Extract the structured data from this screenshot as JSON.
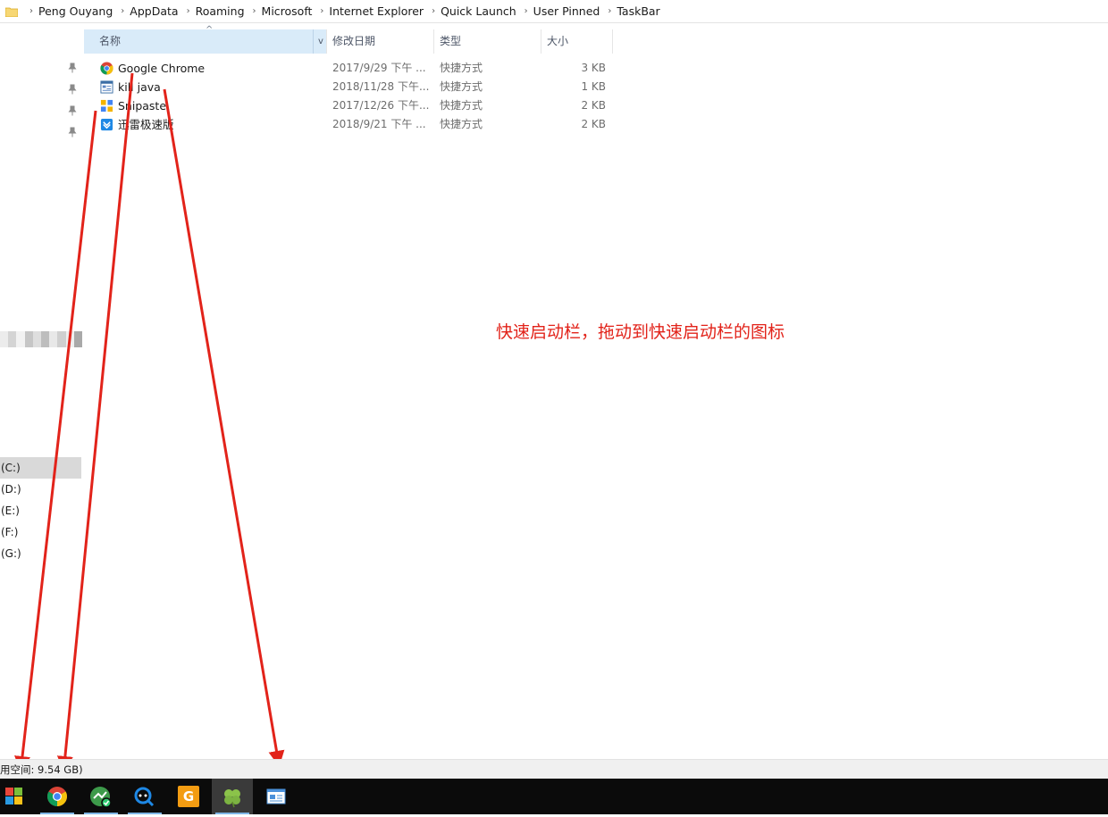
{
  "address_bar": {
    "folder_icon": "folder-icon",
    "crumbs": [
      "Peng Ouyang",
      "AppData",
      "Roaming",
      "Microsoft",
      "Internet Explorer",
      "Quick Launch",
      "User Pinned",
      "TaskBar"
    ],
    "separator": "›"
  },
  "nav_pane": {
    "drives": [
      {
        "label": "(C:)",
        "selected": true
      },
      {
        "label": "(D:)",
        "selected": false
      },
      {
        "label": "(E:)",
        "selected": false
      },
      {
        "label": "(F:)",
        "selected": false
      },
      {
        "label": "(G:)",
        "selected": false
      }
    ]
  },
  "columns": {
    "name": "名称",
    "date": "修改日期",
    "type": "类型",
    "size": "大小",
    "sort_arrow": "^",
    "dropdown": "v"
  },
  "files": [
    {
      "name": "Google Chrome",
      "date": "2017/9/29 下午 ...",
      "type": "快捷方式",
      "size": "3 KB",
      "icon": "chrome-icon"
    },
    {
      "name": "kill java",
      "date": "2018/11/28 下午...",
      "type": "快捷方式",
      "size": "1 KB",
      "icon": "shortcut-icon"
    },
    {
      "name": "Snipaste",
      "date": "2017/12/26 下午...",
      "type": "快捷方式",
      "size": "2 KB",
      "icon": "snipaste-icon"
    },
    {
      "name": "迅雷极速版",
      "date": "2018/9/21 下午 ...",
      "type": "快捷方式",
      "size": "2 KB",
      "icon": "xunlei-icon"
    }
  ],
  "annotation": "快速启动栏，拖动到快速启动栏的图标",
  "status_bar": {
    "text": "用空间: 9.54 GB)"
  },
  "taskbar": {
    "icons": [
      "windows-start-icon",
      "chrome-icon",
      "app-check-icon",
      "search-app-icon",
      "pdf-app-icon",
      "clover-icon",
      "window-icon"
    ]
  },
  "colors": {
    "accent": "#0078d7",
    "annotation_red": "#e2231a",
    "header_selected": "#d9ebf9",
    "taskbar_bg": "#0b0b0b"
  }
}
